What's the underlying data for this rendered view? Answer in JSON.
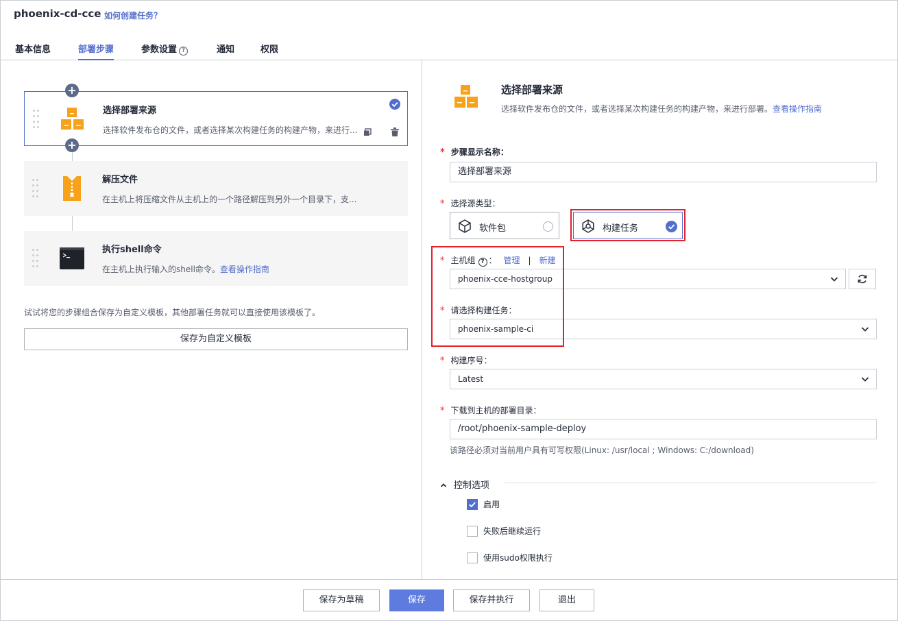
{
  "header": {
    "title": "phoenix-cd-cce",
    "help_link": "如何创建任务？"
  },
  "tabs": [
    {
      "label": "基本信息"
    },
    {
      "label": "部署步骤",
      "active": true
    },
    {
      "label": "参数设置"
    },
    {
      "label": "通知"
    },
    {
      "label": "权限"
    }
  ],
  "steps": [
    {
      "title": "选择部署来源",
      "desc": "选择软件发布仓的文件，或者选择某次构建任务的构建产物，来进行...",
      "icon": "deploy-source-icon",
      "selected": true
    },
    {
      "title": "解压文件",
      "desc": "在主机上将压缩文件从主机上的一个路径解压到另外一个目录下，支...",
      "icon": "zip-file-icon"
    },
    {
      "title": "执行shell命令",
      "desc": "在主机上执行输入的shell命令。",
      "desc_link": "查看操作指南",
      "icon": "terminal-icon"
    }
  ],
  "left": {
    "tip": "试试将您的步骤组合保存为自定义模板，其他部署任务就可以直接使用该模板了。",
    "save_template": "保存为自定义模板"
  },
  "detail": {
    "title": "选择部署来源",
    "desc": "选择软件发布仓的文件，或者选择某次构建任务的构建产物，来进行部署。",
    "desc_link": "查看操作指南",
    "step_name_label": "步骤显示名称：",
    "step_name_value": "选择部署来源",
    "source_type_label": "选择源类型：",
    "source_options": [
      {
        "label": "软件包",
        "selected": false
      },
      {
        "label": "构建任务",
        "selected": true
      }
    ],
    "host_group_label": "主机组",
    "host_group_colon": "：",
    "manage_link": "管理",
    "sep": "|",
    "new_link": "新建",
    "host_group_value": "phoenix-cce-hostgroup",
    "build_task_label": "请选择构建任务：",
    "build_task_value": "phoenix-sample-ci",
    "build_no_label": "构建序号：",
    "build_no_value": "Latest",
    "deploy_dir_label": "下载到主机的部署目录：",
    "deploy_dir_value": "/root/phoenix-sample-deploy",
    "deploy_dir_hint": "该路径必须对当前用户具有可写权限(Linux: /usr/local ; Windows: C:/download)",
    "control_title": "控制选项",
    "controls": [
      {
        "label": "启用",
        "checked": true
      },
      {
        "label": "失败后继续运行",
        "checked": false
      },
      {
        "label": "使用sudo权限执行",
        "checked": false
      }
    ]
  },
  "footer": {
    "save_draft": "保存为草稿",
    "save": "保存",
    "save_run": "保存并执行",
    "exit": "退出"
  },
  "colors": {
    "accent": "#526ecc",
    "primary_button": "#5e7ce0",
    "icon_orange": "#f7a21b",
    "highlight_red": "#e6202c"
  }
}
